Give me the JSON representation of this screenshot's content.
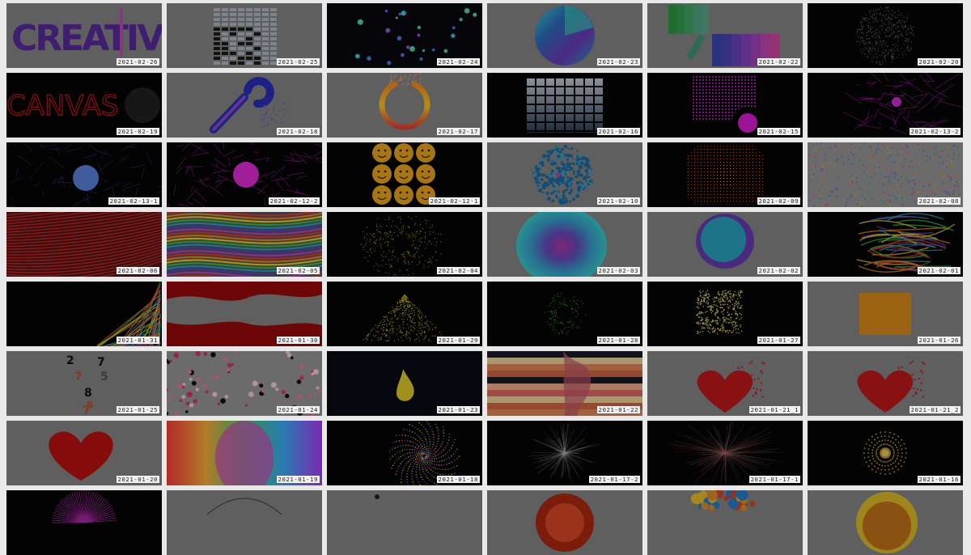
{
  "gallery": {
    "tiles": [
      {
        "date": "2021-02-26",
        "art": "creative-text",
        "bg": "#888888"
      },
      {
        "date": "2021-02-25",
        "art": "bricks-blob",
        "bg": "#888888"
      },
      {
        "date": "2021-02-24",
        "art": "dots-floating",
        "bg": "#0a0a0f"
      },
      {
        "date": "2021-02-23",
        "art": "gradient-pie",
        "bg": "#888888"
      },
      {
        "date": "2021-02-22",
        "art": "color-bars",
        "bg": "#888888"
      },
      {
        "date": "2021-02-20",
        "art": "particle-sphere",
        "bg": "#050505"
      },
      {
        "date": "2021-02-19",
        "art": "canvas-text",
        "bg": "#050505"
      },
      {
        "date": "2021-02-18",
        "art": "wrench",
        "bg": "#888888"
      },
      {
        "date": "2021-02-17",
        "art": "gradient-ring",
        "bg": "#888888"
      },
      {
        "date": "2021-02-16",
        "art": "grid-photo",
        "bg": "#050505"
      },
      {
        "date": "2021-02-15",
        "art": "magenta-grid",
        "bg": "#050505"
      },
      {
        "date": "2021-02-13-2",
        "art": "magenta-web",
        "bg": "#050505"
      },
      {
        "date": "2021-02-13-1",
        "art": "blue-circle-web",
        "bg": "#050505"
      },
      {
        "date": "2021-02-12-2",
        "art": "magenta-circle-web",
        "bg": "#050505"
      },
      {
        "date": "2021-02-12-1",
        "art": "smiley-grid",
        "bg": "#050505"
      },
      {
        "date": "2021-02-10",
        "art": "splatter-circle",
        "bg": "#888888"
      },
      {
        "date": "2021-02-09",
        "art": "orange-dot-grid",
        "bg": "#050505"
      },
      {
        "date": "2021-02-08",
        "art": "confetti",
        "bg": "#9a9a9a"
      },
      {
        "date": "2021-02-06",
        "art": "red-lines",
        "bg": "#5a1414"
      },
      {
        "date": "2021-02-05",
        "art": "rainbow-waves",
        "bg": "#555555"
      },
      {
        "date": "2021-02-04",
        "art": "yellow-dot-lemniscate",
        "bg": "#050505"
      },
      {
        "date": "2021-02-03",
        "art": "gradient-blob",
        "bg": "#888888"
      },
      {
        "date": "2021-02-02",
        "art": "gradient-blob-small",
        "bg": "#888888"
      },
      {
        "date": "2021-02-01",
        "art": "rainbow-streaks",
        "bg": "#050505"
      },
      {
        "date": "2021-01-31",
        "art": "rainbow-corner",
        "bg": "#050505"
      },
      {
        "date": "2021-01-30",
        "art": "red-waves",
        "bg": "#888888"
      },
      {
        "date": "2021-01-29",
        "art": "yellow-triangle",
        "bg": "#050505"
      },
      {
        "date": "2021-01-28",
        "art": "green-ring-dots",
        "bg": "#050505"
      },
      {
        "date": "2021-01-27",
        "art": "yellow-square",
        "bg": "#050505"
      },
      {
        "date": "2021-01-26",
        "art": "orange-square",
        "bg": "#888888"
      },
      {
        "date": "2021-01-25",
        "art": "numbers",
        "bg": "#888888"
      },
      {
        "date": "2021-01-24",
        "art": "pink-dots",
        "bg": "#9a9a9a"
      },
      {
        "date": "2021-01-23",
        "art": "yellow-drop",
        "bg": "#0a0a14"
      },
      {
        "date": "2021-01-22",
        "art": "stripes-warp",
        "bg": "#888888"
      },
      {
        "date": "2021-01-21_1",
        "art": "broken-heart",
        "bg": "#888888"
      },
      {
        "date": "2021-01-21_2",
        "art": "broken-heart",
        "bg": "#888888"
      },
      {
        "date": "2021-01-20",
        "art": "red-heart",
        "bg": "#888888"
      },
      {
        "date": "2021-01-19",
        "art": "rainbow-gradient",
        "bg": "#6a4aa0"
      },
      {
        "date": "2021-01-18",
        "art": "spiral-dots",
        "bg": "#050505"
      },
      {
        "date": "2021-01-17-2",
        "art": "starburst-white",
        "bg": "#050505"
      },
      {
        "date": "2021-01-17-1",
        "art": "starburst-red",
        "bg": "#050505"
      },
      {
        "date": "2021-01-16",
        "art": "yellow-sun-dots",
        "bg": "#050505"
      },
      {
        "date": "",
        "art": "magenta-burst",
        "bg": "#050505"
      },
      {
        "date": "",
        "art": "thin-arc",
        "bg": "#888888"
      },
      {
        "date": "",
        "art": "dark-dot",
        "bg": "#888888"
      },
      {
        "date": "",
        "art": "red-disc",
        "bg": "#888888"
      },
      {
        "date": "",
        "art": "color-balls",
        "bg": "#888888"
      },
      {
        "date": "",
        "art": "yellow-disc",
        "bg": "#888888"
      }
    ]
  }
}
